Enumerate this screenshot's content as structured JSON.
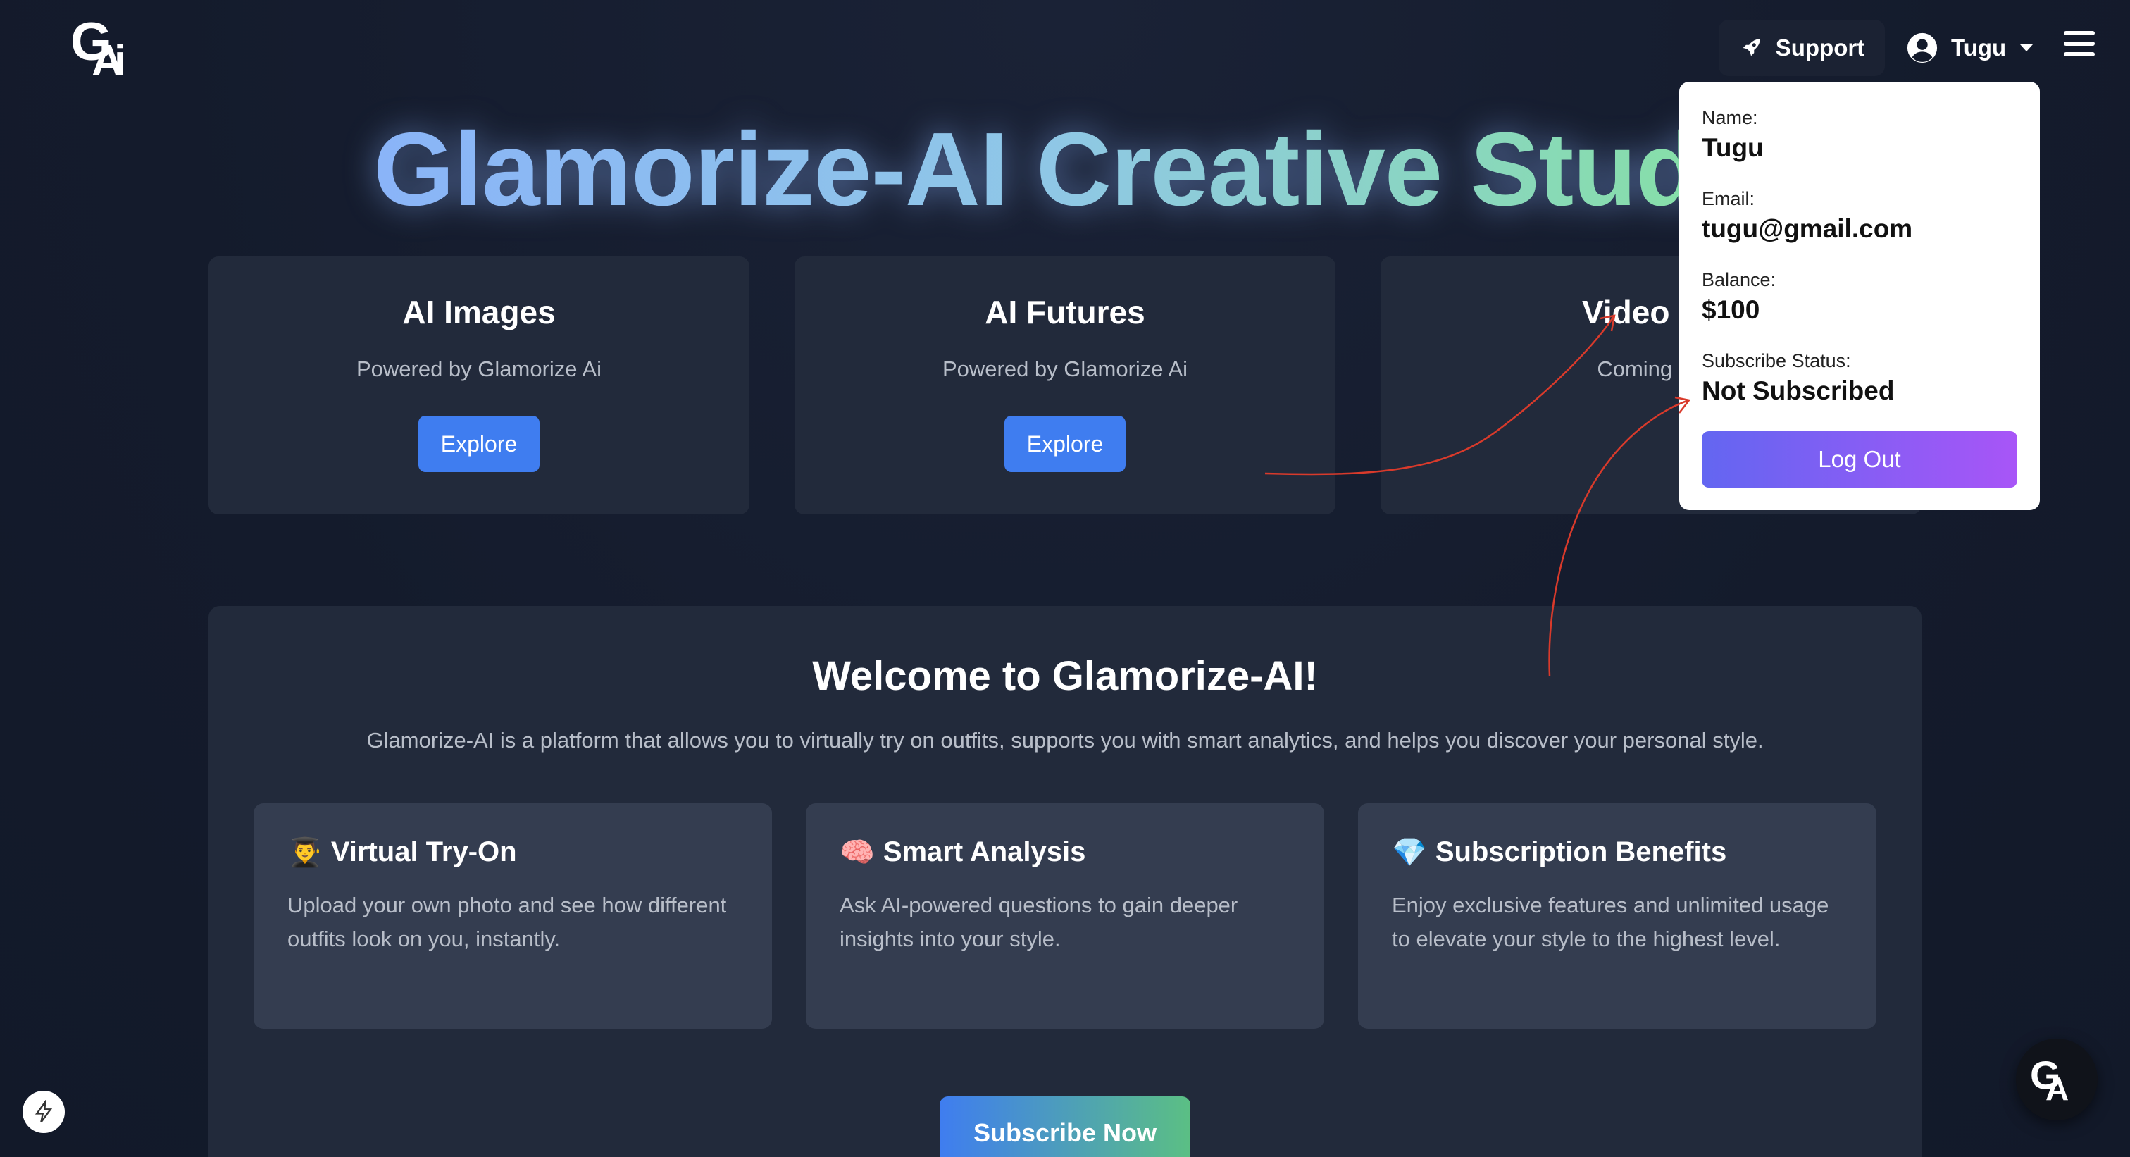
{
  "brand": {
    "logo_g": "G",
    "logo_a": "A",
    "logo_i": "i"
  },
  "header": {
    "support_label": "Support",
    "user_name": "Tugu"
  },
  "hero": {
    "title": "Glamorize-AI Creative Studi"
  },
  "cards": [
    {
      "title": "AI Images",
      "subtitle": "Powered by Glamorize Ai",
      "button": "Explore"
    },
    {
      "title": "AI Futures",
      "subtitle": "Powered by Glamorize Ai",
      "button": "Explore"
    },
    {
      "title": "Video Ed",
      "subtitle": "Coming So"
    }
  ],
  "welcome": {
    "title": "Welcome to Glamorize-AI!",
    "intro": "Glamorize-AI is a platform that allows you to virtually try on outfits, supports you with smart analytics, and helps you discover your personal style.",
    "features": [
      {
        "icon": "👨‍🎓",
        "title": "Virtual Try-On",
        "text": "Upload your own photo and see how different outfits look on you, instantly."
      },
      {
        "icon": "🧠",
        "title": "Smart Analysis",
        "text": "Ask AI-powered questions to gain deeper insights into your style."
      },
      {
        "icon": "💎",
        "title": "Subscription Benefits",
        "text": "Enjoy exclusive features and unlimited usage to elevate your style to the highest level."
      }
    ],
    "subscribe_label": "Subscribe Now"
  },
  "profile_dropdown": {
    "name_label": "Name:",
    "name_value": "Tugu",
    "email_label": "Email:",
    "email_value": "tugu@gmail.com",
    "balance_label": "Balance:",
    "balance_value": "$100",
    "status_label": "Subscribe Status:",
    "status_value": "Not Subscribed",
    "logout_label": "Log Out"
  },
  "colors": {
    "background": "#131a2b",
    "card": "#222a3b",
    "feature_card": "#343d50",
    "primary_button": "#3f7df0",
    "annotation_arrow": "#d93a2b"
  }
}
